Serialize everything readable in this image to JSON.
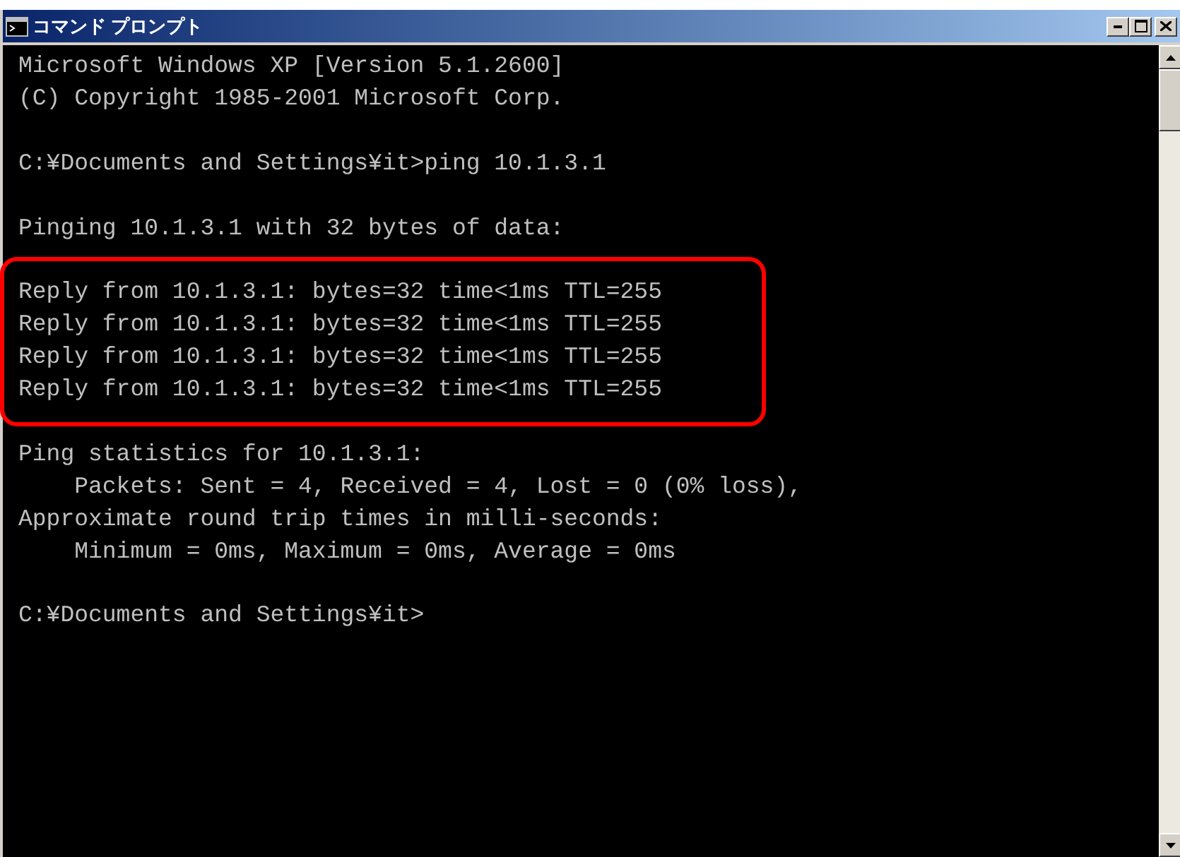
{
  "window": {
    "title": "コマンド プロンプト"
  },
  "console": {
    "blocks": [
      {
        "highlighted": false,
        "lines": [
          "Microsoft Windows XP [Version 5.1.2600]",
          "(C) Copyright 1985-2001 Microsoft Corp."
        ]
      },
      {
        "highlighted": false,
        "lines": [
          "C:¥Documents and Settings¥it>ping 10.1.3.1"
        ]
      },
      {
        "highlighted": false,
        "lines": [
          "Pinging 10.1.3.1 with 32 bytes of data:"
        ]
      },
      {
        "highlighted": true,
        "lines": [
          "Reply from 10.1.3.1: bytes=32 time<1ms TTL=255",
          "Reply from 10.1.3.1: bytes=32 time<1ms TTL=255",
          "Reply from 10.1.3.1: bytes=32 time<1ms TTL=255",
          "Reply from 10.1.3.1: bytes=32 time<1ms TTL=255"
        ]
      },
      {
        "highlighted": false,
        "lines": [
          "Ping statistics for 10.1.3.1:",
          "    Packets: Sent = 4, Received = 4, Lost = 0 (0% loss),",
          "Approximate round trip times in milli-seconds:",
          "    Minimum = 0ms, Maximum = 0ms, Average = 0ms"
        ]
      },
      {
        "highlighted": false,
        "lines": [
          "C:¥Documents and Settings¥it>"
        ]
      }
    ]
  }
}
